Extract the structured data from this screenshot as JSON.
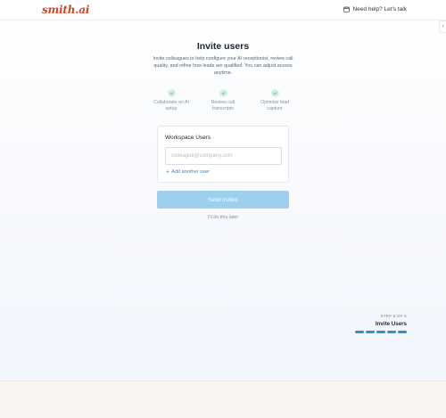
{
  "header": {
    "logo": "smith.ai",
    "help_text": "Need help? Let's talk",
    "side_tab_glyph": "‹"
  },
  "main": {
    "title": "Invite users",
    "subtitle": "Invite colleagues to help configure your AI receptionist, review call quality, and refine how leads are qualified. You can adjust access anytime.",
    "benefits": [
      {
        "icon": "check-icon",
        "label": "Collaborate on AI setup"
      },
      {
        "icon": "check-icon",
        "label": "Review call transcripts"
      },
      {
        "icon": "check-icon",
        "label": "Optimize lead capture"
      }
    ],
    "workspace_card": {
      "title": "Workspace Users",
      "email_placeholder": "colleague@company.com",
      "email_value": "",
      "add_another_label": "Add another user"
    },
    "send_label": "Send invites",
    "skip_label": "I'll do this later"
  },
  "progress": {
    "step_text": "STEP 5 OF 5",
    "step_name": "Invite Users",
    "current_step": 5,
    "total_steps": 5
  },
  "colors": {
    "brand": "#c9492b",
    "accent": "#2f93cf",
    "button_disabled": "#9cd0ec",
    "check_bg": "#d8efe2"
  }
}
